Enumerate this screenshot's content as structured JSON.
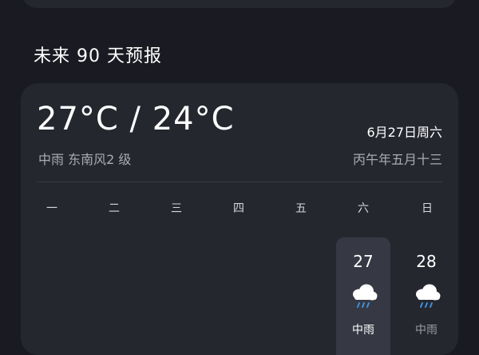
{
  "header": {
    "section_title": "未来 90 天预报"
  },
  "summary": {
    "temp_range": "27°C / 24°C",
    "description": "中雨 东南风2 级",
    "date": "6月27日周六",
    "lunar": "丙午年五月十三"
  },
  "calendar": {
    "weekdays": [
      "一",
      "二",
      "三",
      "四",
      "五",
      "六",
      "日"
    ],
    "days": [
      {
        "day": "27",
        "condition": "中雨",
        "icon": "rain-cloud-icon",
        "selected": true
      },
      {
        "day": "28",
        "condition": "中雨",
        "icon": "rain-cloud-icon",
        "selected": false
      }
    ]
  },
  "colors": {
    "background": "#1a1b22",
    "card": "#25272f",
    "selected_cell": "#363944",
    "rain_drop": "#3e8fd8"
  }
}
